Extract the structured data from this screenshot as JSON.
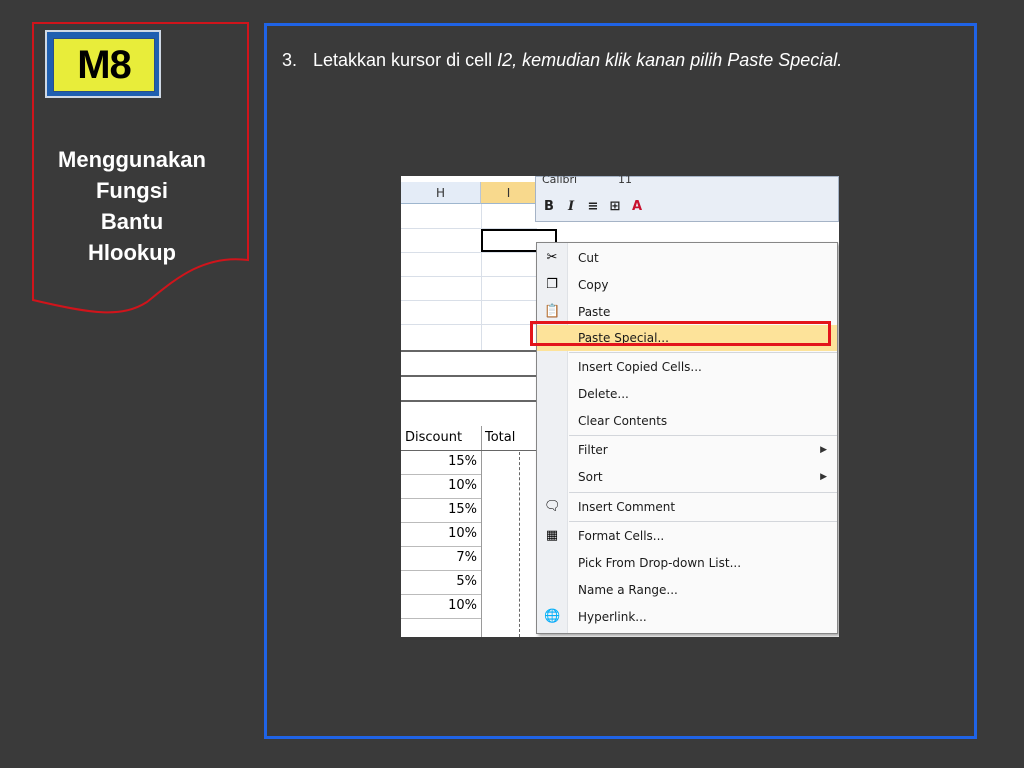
{
  "banner": {
    "logo_text": "M8",
    "title_lines": [
      "Menggunakan",
      "Fungsi",
      "Bantu",
      "Hlookup"
    ]
  },
  "step": {
    "number": "3.",
    "text_plain": "Letakkan kursor di cell ",
    "text_italic": "I2, kemudian klik kanan pilih Paste Special."
  },
  "sheet": {
    "columns": [
      "H",
      "I"
    ],
    "headers": [
      "Discount",
      "Total"
    ],
    "discount_values": [
      "15%",
      "10%",
      "15%",
      "10%",
      "7%",
      "5%",
      "10%"
    ]
  },
  "mini_toolbar": {
    "font_name": "Calibri",
    "font_size": "11",
    "buttons": [
      "B",
      "I",
      "≡",
      "⊞",
      "A"
    ]
  },
  "context_menu": {
    "items": [
      {
        "label": "Cut",
        "icon": "scissors-icon",
        "glyph": "✂"
      },
      {
        "label": "Copy",
        "icon": "copy-icon",
        "glyph": "❐"
      },
      {
        "label": "Paste",
        "icon": "paste-icon",
        "glyph": "📋"
      },
      {
        "label": "Paste Special...",
        "icon": "",
        "glyph": ""
      },
      {
        "label": "Insert Copied Cells...",
        "icon": "",
        "glyph": ""
      },
      {
        "label": "Delete...",
        "icon": "",
        "glyph": ""
      },
      {
        "label": "Clear Contents",
        "icon": "",
        "glyph": ""
      },
      {
        "label": "Filter",
        "icon": "",
        "glyph": "",
        "submenu": "▶"
      },
      {
        "label": "Sort",
        "icon": "",
        "glyph": "",
        "submenu": "▶"
      },
      {
        "label": "Insert Comment",
        "icon": "comment-icon",
        "glyph": "🗨"
      },
      {
        "label": "Format Cells...",
        "icon": "format-cells-icon",
        "glyph": "▦"
      },
      {
        "label": "Pick From Drop-down List...",
        "icon": "",
        "glyph": ""
      },
      {
        "label": "Name a Range...",
        "icon": "",
        "glyph": ""
      },
      {
        "label": "Hyperlink...",
        "icon": "hyperlink-icon",
        "glyph": "🌐"
      }
    ]
  },
  "colors": {
    "background": "#3a3a3a",
    "banner_border": "#d0141b",
    "frame_border": "#1f63e6",
    "highlight_border": "#e3141b",
    "highlight_fill": "#fde39a"
  }
}
